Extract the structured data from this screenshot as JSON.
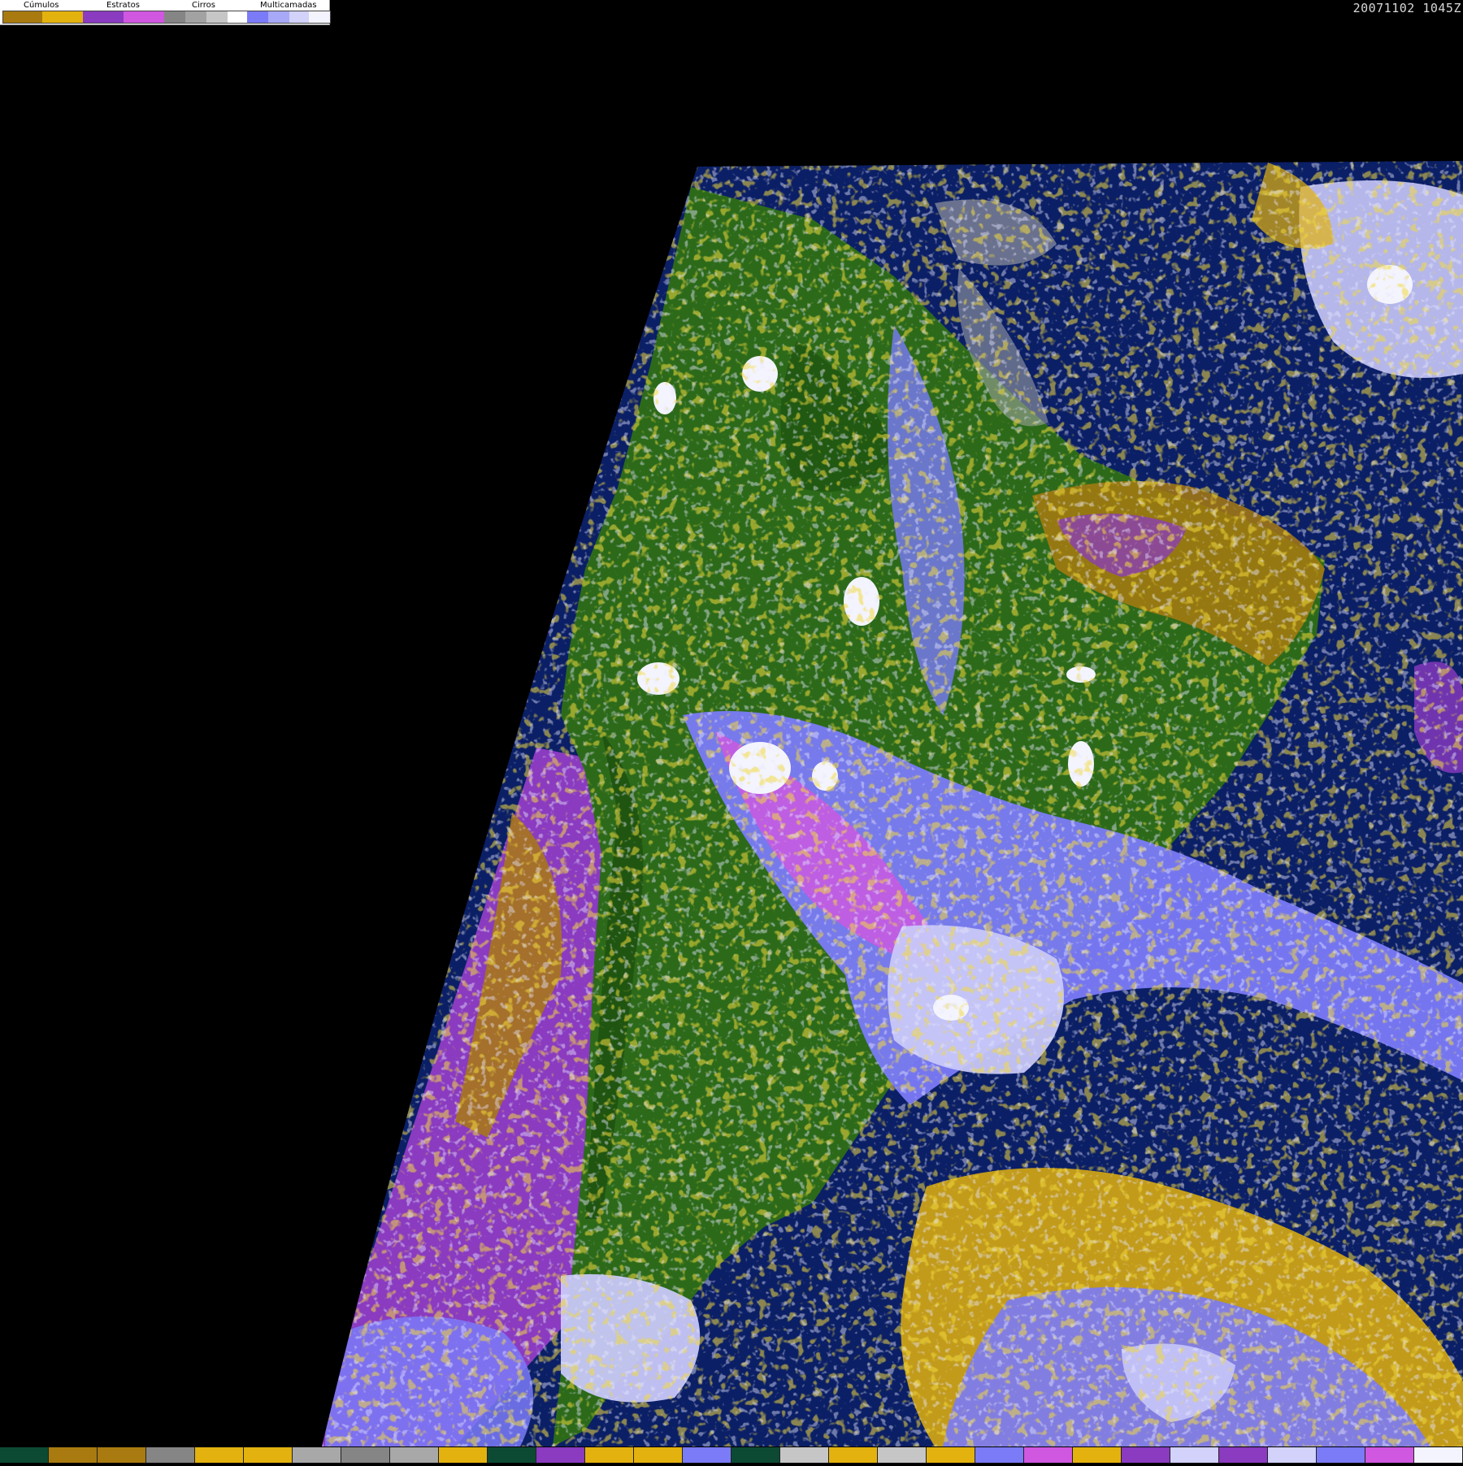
{
  "timestamp": "20071102 1045Z",
  "legend": {
    "groups": [
      {
        "label": "Cúmulos"
      },
      {
        "label": "Estratos"
      },
      {
        "label": "Cirros"
      },
      {
        "label": "Multicamadas"
      }
    ],
    "swatches": [
      "#a87a10",
      "#e3b20e",
      "#8a3bc0",
      "#d057e0",
      "#858585",
      "#a2a2a2",
      "#c6c6c6",
      "#ffffff",
      "#7b7bf7",
      "#a8a8f8",
      "#d2d2fa",
      "#f4f4fe"
    ]
  },
  "colors": {
    "ocean": "#0b1f66",
    "land": "#2c6a1a",
    "land_dark": "#1f5510",
    "cumulus_brown": "#a87a10",
    "cumulus_yellow": "#e3b20e",
    "stratus_purple": "#8a3bc0",
    "stratus_magenta": "#d057e0",
    "cirrus_gray": "#a8a8a8",
    "multi_blue": "#7b7bf7",
    "multi_lavender": "#c8c8f8",
    "background": "#000000"
  },
  "bottom_strip": [
    "#0d4a33",
    "#a87a10",
    "#a87a10",
    "#858585",
    "#e3b20e",
    "#e3b20e",
    "#a8a8a8",
    "#858585",
    "#a8a8a8",
    "#e3b20e",
    "#0d4a33",
    "#8a3bc0",
    "#e3b20e",
    "#e3b20e",
    "#7b7bf7",
    "#0d4a33",
    "#c6c6c6",
    "#e3b20e",
    "#c6c6c6",
    "#e3b20e",
    "#7b7bf7",
    "#d057e0",
    "#e3b20e",
    "#8a3bc0",
    "#d2d2fa",
    "#8a3bc0",
    "#d2d2fa",
    "#7b7bf7",
    "#d057e0",
    "#f4f4fe"
  ]
}
